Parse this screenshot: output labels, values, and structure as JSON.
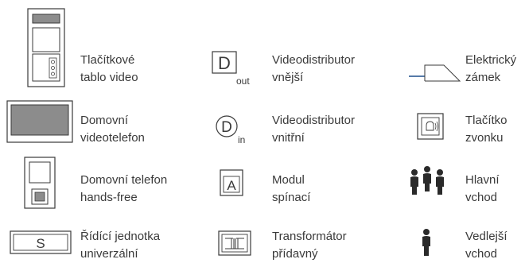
{
  "legend": [
    {
      "symbol": "video-panel-icon",
      "lines": [
        "Tlačítkové",
        "tablo video"
      ]
    },
    {
      "symbol": "video-distributor-external-icon",
      "lines": [
        "Videodistributor",
        "vnější"
      ],
      "glyph": "D",
      "sub": "out"
    },
    {
      "symbol": "electric-lock-icon",
      "lines": [
        "Elektrický",
        "zámek"
      ]
    },
    {
      "symbol": "video-phone-icon",
      "lines": [
        "Domovní",
        "videotelefon"
      ]
    },
    {
      "symbol": "video-distributor-internal-icon",
      "lines": [
        "Videodistributor",
        "vnitřní"
      ],
      "glyph": "D",
      "sub": "in"
    },
    {
      "symbol": "bell-button-icon",
      "lines": [
        "Tlačítko",
        "zvonku"
      ]
    },
    {
      "symbol": "handsfree-phone-icon",
      "lines": [
        "Domovní telefon",
        "hands-free"
      ]
    },
    {
      "symbol": "switch-module-icon",
      "lines": [
        "Modul",
        "spínací"
      ],
      "glyph": "A"
    },
    {
      "symbol": "main-entrance-people-icon",
      "lines": [
        "Hlavní",
        "vchod"
      ]
    },
    {
      "symbol": "control-unit-icon",
      "lines": [
        "Řídící jednotka",
        "univerzální"
      ],
      "glyph": "S"
    },
    {
      "symbol": "transformer-icon",
      "lines": [
        "Transformátor",
        "přídavný"
      ]
    },
    {
      "symbol": "side-entrance-person-icon",
      "lines": [
        "Vedlejší",
        "vchod"
      ]
    }
  ],
  "colors": {
    "stroke": "#3a3a3a",
    "screen": "#8c8c8c",
    "lock_wire": "#1f4e8c",
    "text": "#3a3a3a"
  }
}
